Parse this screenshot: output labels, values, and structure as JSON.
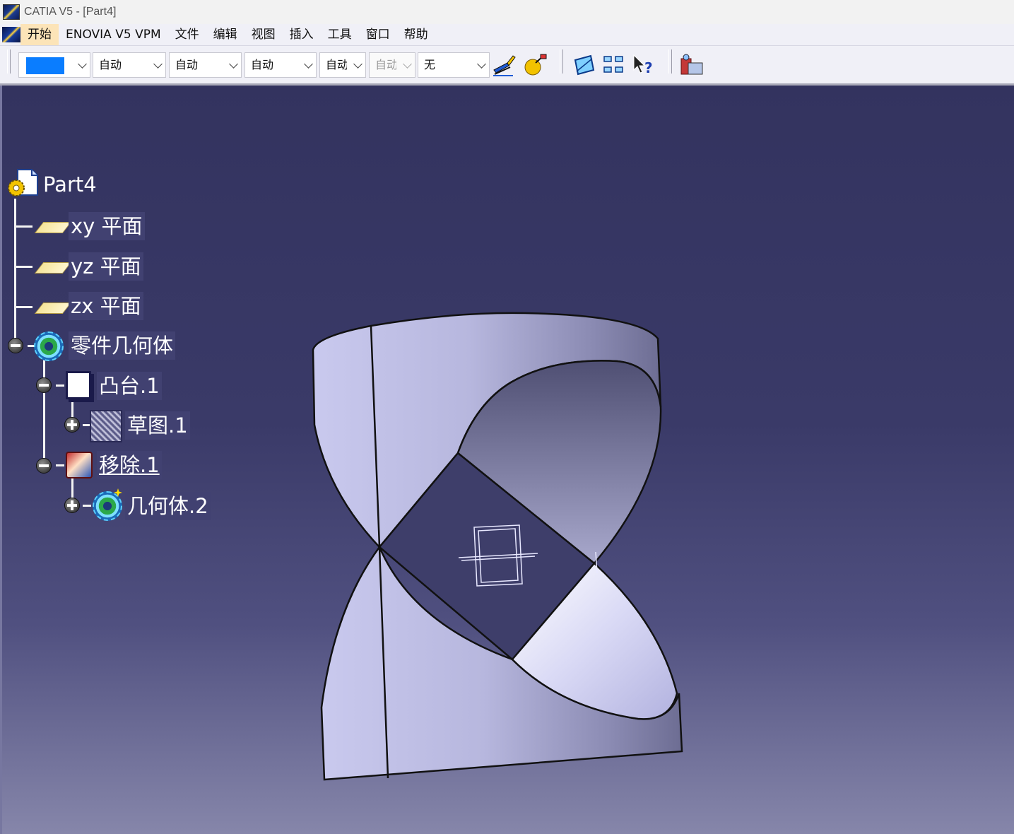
{
  "window": {
    "title": "CATIA V5 - [Part4]",
    "app_icon": "catia-logo-icon"
  },
  "menu": {
    "items": [
      "开始",
      "ENOVIA V5 VPM",
      "文件",
      "编辑",
      "视图",
      "插入",
      "工具",
      "窗口",
      "帮助"
    ],
    "active_item": "开始"
  },
  "toolbar": {
    "color_swatch": "#0a7dff",
    "combos": [
      "自动",
      "自动",
      "自动",
      "自动",
      "自动",
      "无"
    ],
    "icons": [
      "painter-brush-icon",
      "material-sphere-icon",
      "geometry-plane-icon",
      "quick-select-icon",
      "whats-this-icon",
      "catalog-browser-icon"
    ]
  },
  "viewport": {
    "background_top": "#33335f",
    "background_bottom": "#8686aa",
    "part_color": "#c9c9ee"
  },
  "tree": {
    "root": "Part4",
    "planes": [
      "xy 平面",
      "yz 平面",
      "zx 平面"
    ],
    "body": "零件几何体",
    "pad": "凸台.1",
    "sketch": "草图.1",
    "pocket": "移除.1",
    "body2": "几何体.2"
  }
}
